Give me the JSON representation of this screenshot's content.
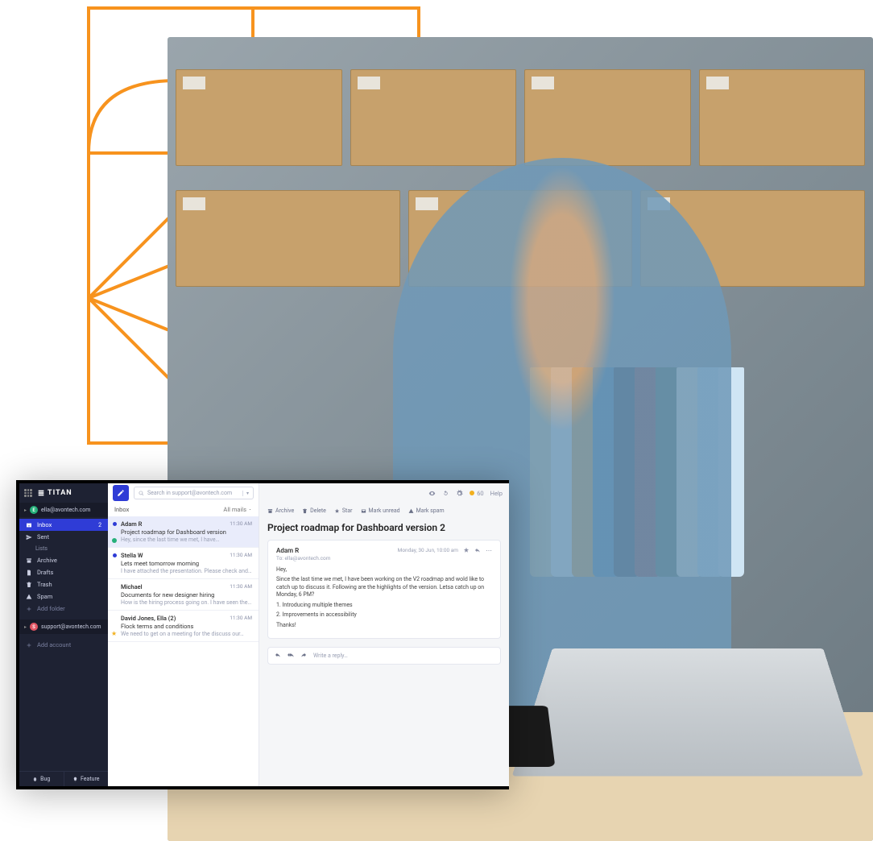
{
  "brand": "TITAN",
  "accounts": [
    {
      "email": "ella@avontech.com",
      "initial": "E",
      "color": "green"
    },
    {
      "email": "support@avontech.com",
      "initial": "S",
      "color": "red"
    }
  ],
  "nav": {
    "inbox": {
      "label": "Inbox",
      "count": "2"
    },
    "sent": "Sent",
    "lists": "Lists",
    "archive": "Archive",
    "drafts": "Drafts",
    "trash": "Trash",
    "spam": "Spam",
    "add_folder": "Add folder",
    "add_account": "Add account"
  },
  "bottom": {
    "bug": "Bug",
    "feature": "Feature"
  },
  "search": {
    "placeholder": "Search in support@avontech.com"
  },
  "topright": {
    "cal": "60",
    "help": "Help"
  },
  "list": {
    "title": "Inbox",
    "filter": "All mails",
    "items": [
      {
        "from": "Adam R",
        "time": "11:30 AM",
        "subject": "Project roadmap for Dashboard version",
        "preview": "Hey, since the last time we met, I have…",
        "unread": true,
        "selected": true,
        "online": true
      },
      {
        "from": "Stella W",
        "time": "11:30 AM",
        "subject": "Lets meet tomorrow morning",
        "preview": "I have attached the presentation. Please check and…",
        "unread": true
      },
      {
        "from": "Michael",
        "time": "11:30 AM",
        "subject": "Documents for new designer hiring",
        "preview": "How is the hiring process going on. I have seen the…"
      },
      {
        "from": "David Jones, Ella (2)",
        "time": "11:30 AM",
        "subject": "Flock terms and conditions",
        "preview": "We need to get on a meeting for the discuss our…",
        "starred": true
      }
    ]
  },
  "actions": {
    "archive": "Archive",
    "delete": "Delete",
    "star": "Star",
    "mark_unread": "Mark unread",
    "mark_spam": "Mark spam"
  },
  "reader": {
    "subject": "Project roadmap for Dashboard version 2",
    "from": "Adam R",
    "to": "To: ella@avontech.com",
    "date": "Monday, 30 Jun, 10:00 am",
    "body": {
      "p1": "Hey,",
      "p2": "Since the last time we met, I have been working on the V2 roadmap and wold like to catch up to discuss it. Following are the highlights of the version. Letsa catch up on Monday, 6 PM?",
      "l1": "1. Introducing multiple themes",
      "l2": "2. Improvements in accessibility",
      "p3": "Thanks!"
    },
    "reply_placeholder": "Write a reply…"
  }
}
